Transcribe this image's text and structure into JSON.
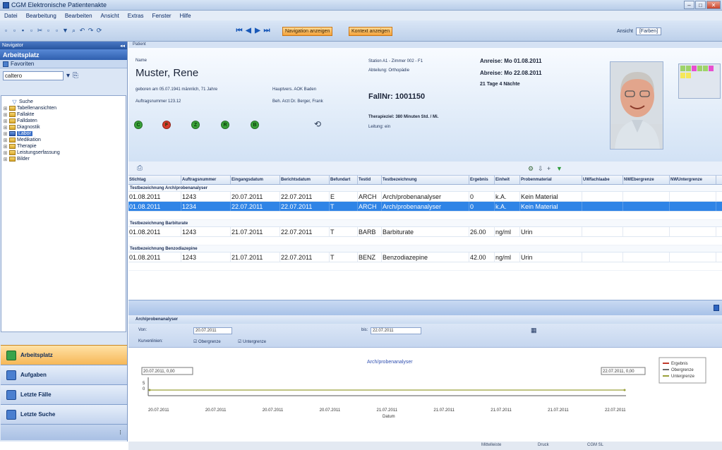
{
  "window": {
    "title": "CGM Elektronische Patientenakte"
  },
  "menu": {
    "items": [
      "Datei",
      "Bearbeitung",
      "Bearbeiten",
      "Ansicht",
      "Extras",
      "Fenster",
      "Hilfe"
    ]
  },
  "toolbar": {
    "navigation_label": "Navigation anzeigen",
    "context_label": "Kontext anzeigen",
    "view_label": "Ansicht",
    "view_value": "[Farben]"
  },
  "left": {
    "nav_title": "Navigator",
    "section_title": "Arbeitsplatz",
    "favorites": "Favoriten",
    "search_value": "caltero",
    "tree": [
      {
        "label": "Suche",
        "type": "search"
      },
      {
        "label": "Tabellenansichten",
        "type": "folder"
      },
      {
        "label": "Fallakte",
        "type": "folder"
      },
      {
        "label": "Falldaten",
        "type": "folder"
      },
      {
        "label": "Diagnostik",
        "type": "folder"
      },
      {
        "label": "Labor",
        "type": "selected"
      },
      {
        "label": "Medikation",
        "type": "folder"
      },
      {
        "label": "Therapie",
        "type": "folder"
      },
      {
        "label": "Leistungserfassung",
        "type": "folder"
      },
      {
        "label": "Bilder",
        "type": "folder"
      }
    ],
    "nav_buttons": [
      "Arbeitsplatz",
      "Aufgaben",
      "Letzte Fälle",
      "Letzte Suche"
    ]
  },
  "patient": {
    "header": "Patient",
    "label": "Name",
    "name": "Muster, Rene",
    "born": "geboren am 05.07.1941 männlich, 71 Jahre",
    "insurance": "Hauptvers. AOK Baden",
    "order_no": "Auftragsnummer 123.12",
    "doctor": "Beh. Arzt Dr. Berger, Frank",
    "ward": "Station A1 - Zimmer 002 - F1",
    "department": "Abteilung: Orthopädie",
    "fall_label": "FallNr: 1001150",
    "therapy": "Therapieziel: 380 Minuten Std. / Mi.",
    "extra": "Leitung: ein",
    "arrival": "Anreise: Mo 01.08.2011",
    "departure": "Abreise: Mo 22.08.2011",
    "days": "21 Tage 4 Nächte",
    "status_letters": [
      "C",
      "F",
      "Z",
      "R",
      "B"
    ],
    "status_colors": [
      "#3aa33a",
      "#d83a2a",
      "#3aa33a",
      "#3aa33a",
      "#3aa33a"
    ],
    "refresh_icon": "refresh-icon"
  },
  "grid": {
    "columns": [
      "Stichtag",
      "Auftragsnummer",
      "Eingangsdatum",
      "Berichtsdatum",
      "Befundart",
      "Testid",
      "Testbezeichnung",
      "Ergebnis",
      "Einheit",
      "Probenmaterial",
      "UWfachlaabe",
      "NWEbergrenze",
      "NWUntergrenze"
    ],
    "groups": [
      {
        "title": "Testbezeichnung Arch/probenanalyser",
        "rows": [
          {
            "cells": [
              "01.08.2011",
              "1243",
              "20.07.2011",
              "22.07.2011",
              "E",
              "ARCH",
              "Arch/probenanalyser",
              "0",
              "k.A.",
              "Kein Material"
            ],
            "selected": false
          },
          {
            "cells": [
              "01.08.2011",
              "1234",
              "22.07.2011",
              "22.07.2011",
              "T",
              "ARCH",
              "Arch/probenanalyser",
              "0",
              "k.A.",
              "Kein Material"
            ],
            "selected": true
          }
        ]
      },
      {
        "title": "Testbezeichnung Barbiturate",
        "rows": [
          {
            "cells": [
              "01.08.2011",
              "1243",
              "21.07.2011",
              "22.07.2011",
              "T",
              "BARB",
              "Barbiturate",
              "26.00",
              "ng/ml",
              "Urin"
            ],
            "selected": false
          }
        ]
      },
      {
        "title": "Testbezeichnung Benzodiazepine",
        "rows": [
          {
            "cells": [
              "01.08.2011",
              "1243",
              "21.07.2011",
              "22.07.2011",
              "T",
              "BENZ",
              "Benzodiazepine",
              "42.00",
              "ng/ml",
              "Urin"
            ],
            "selected": false
          }
        ]
      }
    ]
  },
  "lower": {
    "section": "Arch/probenanalyser",
    "from_label": "Von:",
    "from_value": "20.07.2011",
    "to_label": "bis:",
    "to_value": "22.07.2011",
    "curve_label": "Kurvenlinien:",
    "check1": "Obergrenze",
    "check2": "Untergrenze",
    "chart_title": "Arch/probenanalyser",
    "x_axis_label": "Datum",
    "ticks": [
      "20.07.2011",
      "20.07.2011",
      "20.07.2011",
      "20.07.2011",
      "21.07.2011",
      "21.07.2011",
      "21.07.2011",
      "21.07.2011",
      "22.07.2011"
    ],
    "tooltip_left": "20.07.2011, 0,00",
    "tooltip_right": "22.07.2011, 0,00",
    "y_tick_a": "5",
    "y_tick_b": "0",
    "legend": [
      "Ergebnis",
      "Obergrenze",
      "Untergrenze"
    ],
    "legend_colors": [
      "#c0392b",
      "#6a6a6a",
      "#9aa03a"
    ]
  },
  "chart_data": {
    "type": "line",
    "title": "Arch/probenanalyser",
    "xlabel": "Datum",
    "x": [
      "20.07.2011",
      "22.07.2011"
    ],
    "series": [
      {
        "name": "Ergebnis",
        "values": [
          0,
          0
        ]
      }
    ]
  },
  "status": {
    "left": "Mittelleiste",
    "mid": "Druck",
    "right": "CGM SL"
  }
}
